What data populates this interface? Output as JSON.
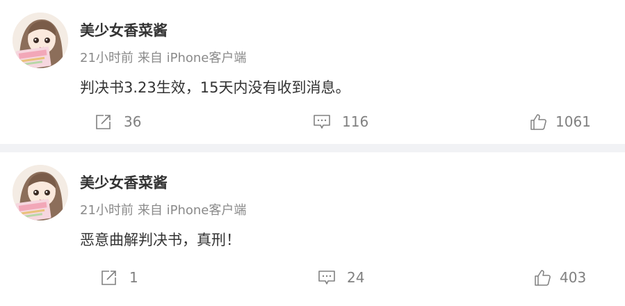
{
  "posts": [
    {
      "author": "美少女香菜酱",
      "time": "21小时前",
      "source": "来自 iPhone客户端",
      "text": "判决书3.23生效，15天内没有收到消息。",
      "reposts": "36",
      "comments": "116",
      "likes": "1061"
    },
    {
      "author": "美少女香菜酱",
      "time": "21小时前",
      "source": "来自 iPhone客户端",
      "text": "恶意曲解判决书，真刑！",
      "reposts": "1",
      "comments": "24",
      "likes": "403"
    }
  ],
  "icons": {
    "repost": "repost-icon",
    "comment": "comment-icon",
    "like": "like-icon"
  },
  "colors": {
    "meta_text": "#8a8a8a",
    "action_icon": "#808080",
    "divider": "#f1f2f5"
  }
}
